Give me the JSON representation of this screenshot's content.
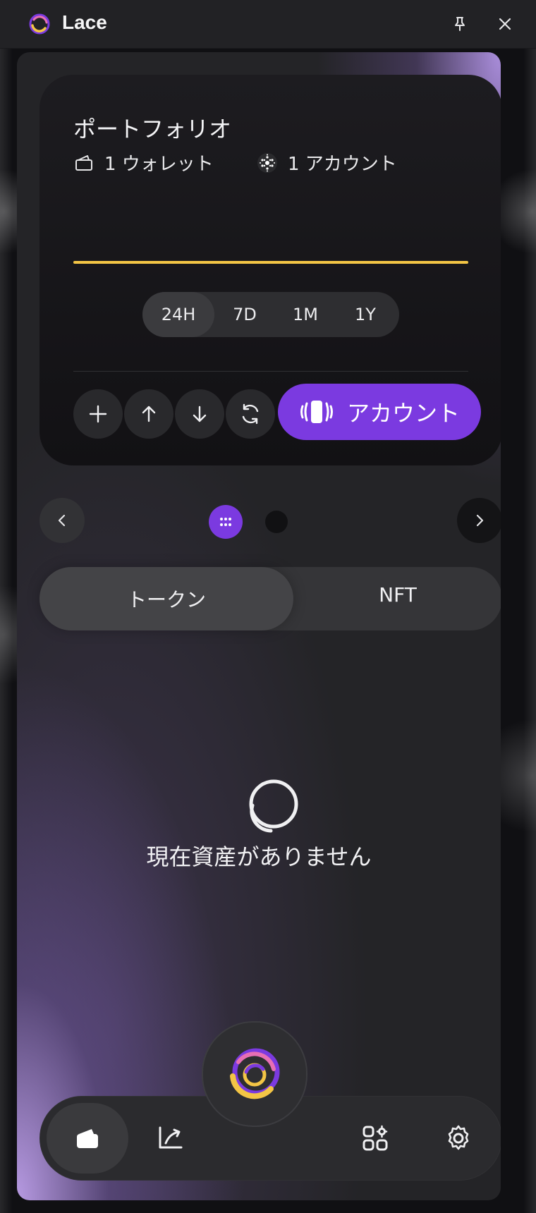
{
  "app": {
    "title": "Lace"
  },
  "titlebar": {
    "icons": [
      "lace-logo-icon",
      "pin-icon",
      "close-icon"
    ]
  },
  "portfolio": {
    "title": "ポートフォリオ",
    "wallet_count": "1 ウォレット",
    "account_count": "1 アカウント",
    "line_color": "#f3c545",
    "ranges": [
      "24H",
      "7D",
      "1M",
      "1Y"
    ],
    "selected_range": "24H",
    "actions": [
      "add-icon",
      "send-icon",
      "receive-icon",
      "swap-icon"
    ],
    "account_button_label": "アカウント"
  },
  "pager": {
    "icons": [
      "chevron-left-icon",
      "chevron-right-icon"
    ],
    "active_page": 1,
    "page_count": 2
  },
  "tabs": {
    "tokens": "トークン",
    "nft": "NFT",
    "selected": "トークン"
  },
  "empty_state": {
    "message": "現在資産がありません",
    "icon": "coins-icon"
  },
  "bottom_nav": {
    "items": [
      "wallet-icon",
      "activity-icon",
      "lace-logo-icon",
      "dapps-icon",
      "settings-icon"
    ],
    "selected": "wallet-icon"
  },
  "colors": {
    "accent": "#7b3ae0",
    "chart_line": "#f3c545",
    "background": "#242427"
  }
}
